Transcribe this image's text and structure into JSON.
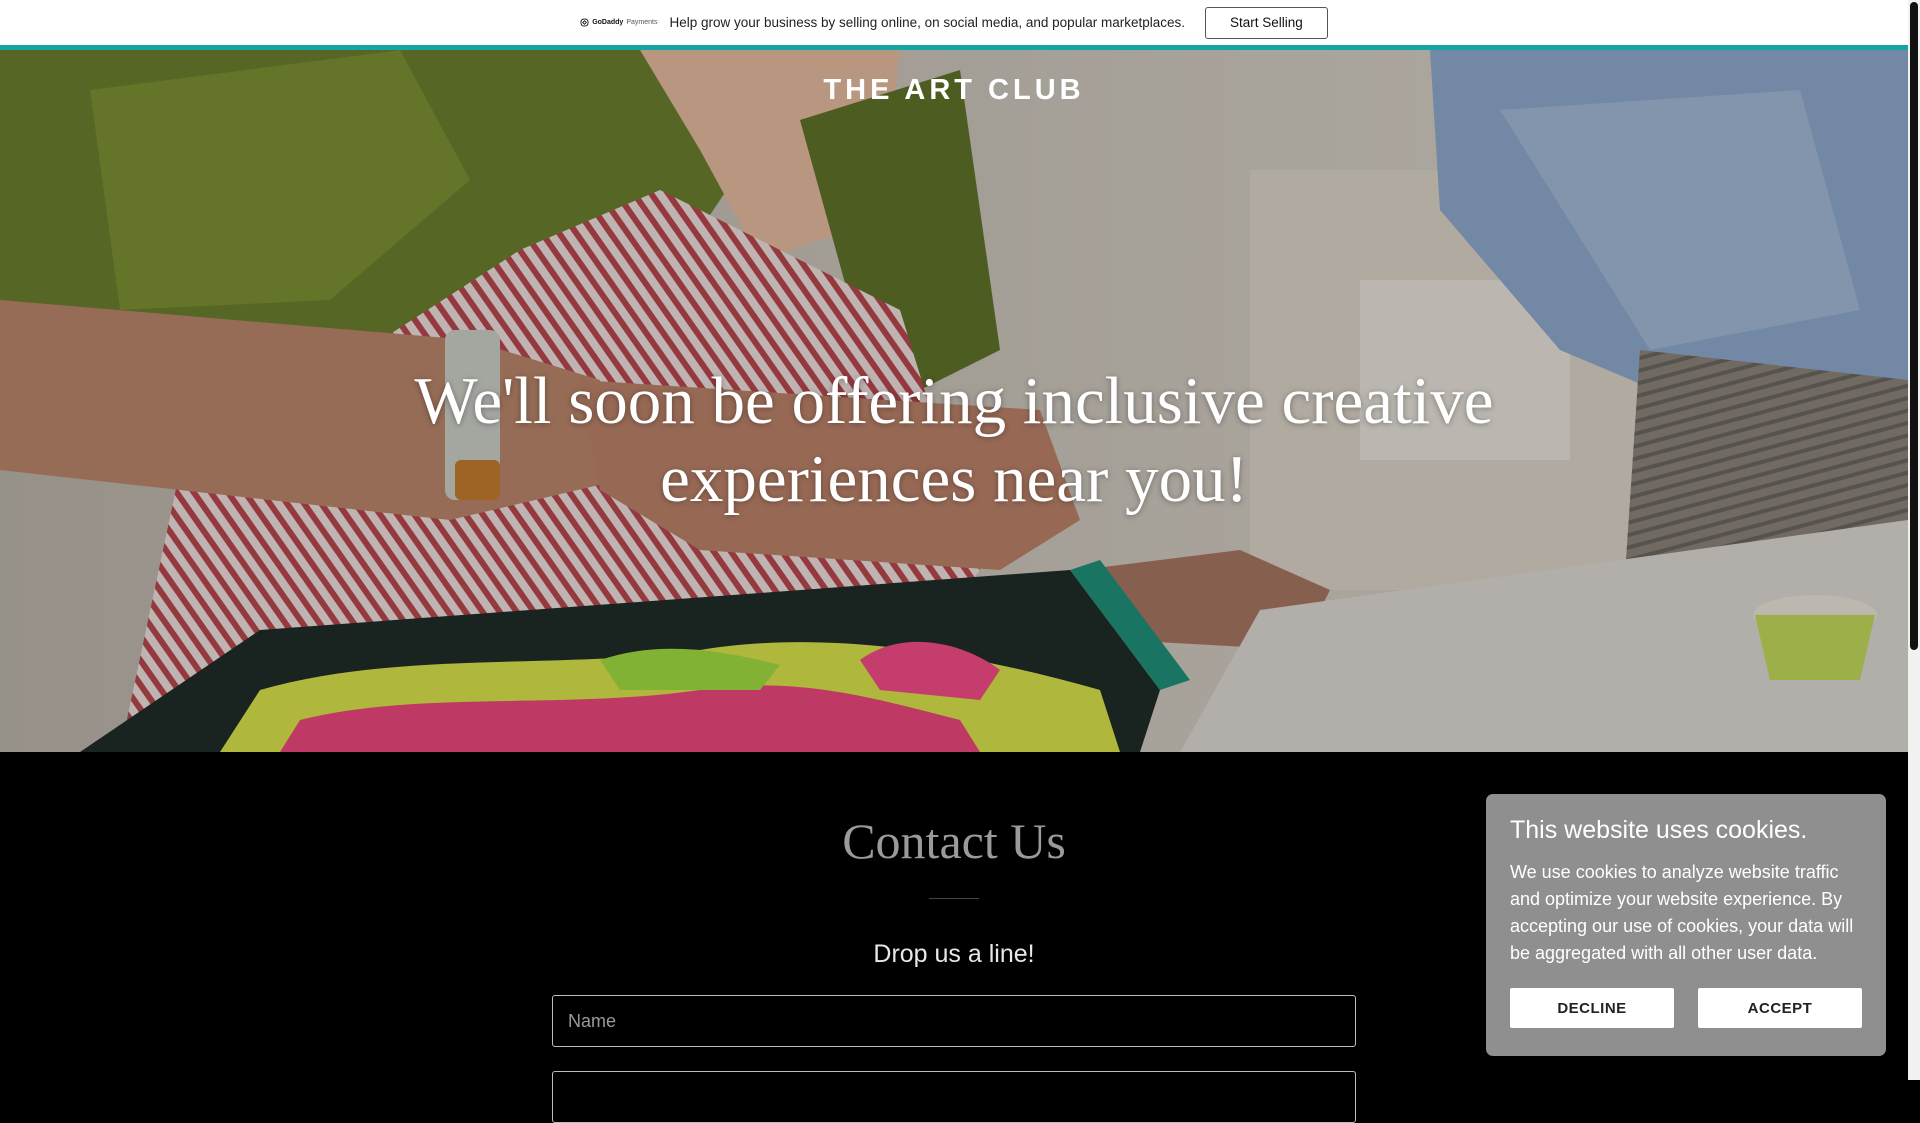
{
  "promo": {
    "logo_brand": "GoDaddy",
    "logo_product": "Payments",
    "message": "Help grow your business by selling online, on social media, and popular marketplaces.",
    "button_label": "Start Selling"
  },
  "hero": {
    "site_title": "THE ART CLUB",
    "headline": "We'll soon be offering inclusive creative experiences near you!"
  },
  "contact": {
    "title": "Contact Us",
    "subtitle": "Drop us a line!",
    "name_placeholder": "Name",
    "email_placeholder": ""
  },
  "cookie_banner": {
    "title": "This website uses cookies.",
    "text": "We use cookies to analyze website traffic and optimize your website experience. By accepting our use of cookies, your data will be aggregated with all other user data.",
    "decline_label": "DECLINE",
    "accept_label": "ACCEPT"
  },
  "colors": {
    "accent_teal": "#16a5a5",
    "cookie_bg": "#8f8f8f",
    "page_bg": "#000000"
  }
}
